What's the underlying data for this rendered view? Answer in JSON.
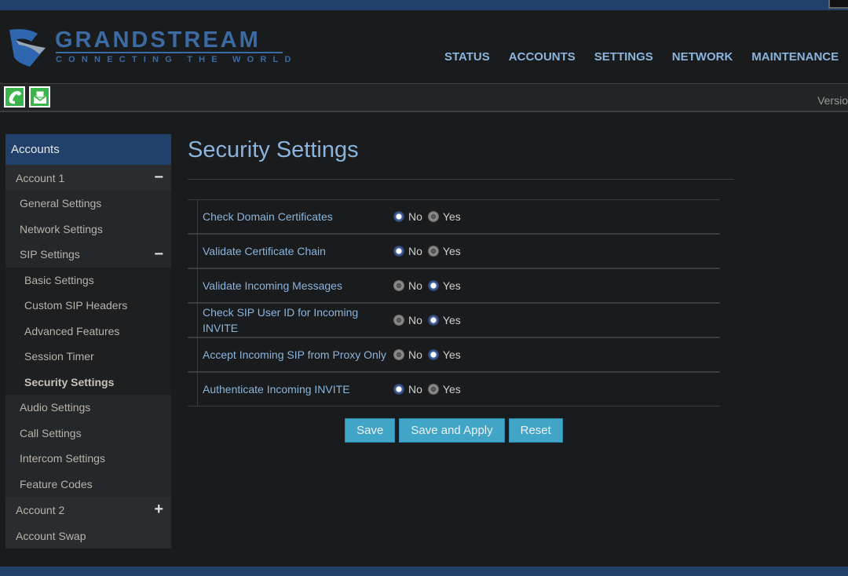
{
  "brand": {
    "name": "GRANDSTREAM",
    "tagline": "CONNECTING THE WORLD"
  },
  "nav": [
    "STATUS",
    "ACCOUNTS",
    "SETTINGS",
    "NETWORK",
    "MAINTENANCE"
  ],
  "toolbar": {
    "version_label": "Versio",
    "icons": [
      "phone-icon",
      "message-icon"
    ]
  },
  "sidebar": {
    "title": "Accounts",
    "items": [
      {
        "label": "Account 1",
        "level": 1,
        "toggle": "−"
      },
      {
        "label": "General Settings",
        "level": 2
      },
      {
        "label": "Network Settings",
        "level": 2
      },
      {
        "label": "SIP Settings",
        "level": 2,
        "toggle": "−"
      },
      {
        "label": "Basic Settings",
        "level": 3
      },
      {
        "label": "Custom SIP Headers",
        "level": 3
      },
      {
        "label": "Advanced Features",
        "level": 3
      },
      {
        "label": "Session Timer",
        "level": 3
      },
      {
        "label": "Security Settings",
        "level": 3,
        "active": true
      },
      {
        "label": "Audio Settings",
        "level": 2
      },
      {
        "label": "Call Settings",
        "level": 2
      },
      {
        "label": "Intercom Settings",
        "level": 2
      },
      {
        "label": "Feature Codes",
        "level": 2
      },
      {
        "label": "Account 2",
        "level": 1,
        "toggle": "+"
      },
      {
        "label": "Account Swap",
        "level": 1
      }
    ]
  },
  "page": {
    "title": "Security Settings",
    "no_label": "No",
    "yes_label": "Yes",
    "settings": [
      {
        "label": "Check Domain Certificates",
        "value": "No"
      },
      {
        "label": "Validate Certificate Chain",
        "value": "No"
      },
      {
        "label": "Validate Incoming Messages",
        "value": "Yes"
      },
      {
        "label": "Check SIP User ID for Incoming INVITE",
        "value": "Yes"
      },
      {
        "label": "Accept Incoming SIP from Proxy Only",
        "value": "Yes"
      },
      {
        "label": "Authenticate Incoming INVITE",
        "value": "No"
      }
    ]
  },
  "buttons": {
    "save": "Save",
    "save_apply": "Save and Apply",
    "reset": "Reset"
  },
  "colors": {
    "accent": "#41a5c8",
    "header_blue": "#21416a",
    "link": "#8ab4dc"
  }
}
